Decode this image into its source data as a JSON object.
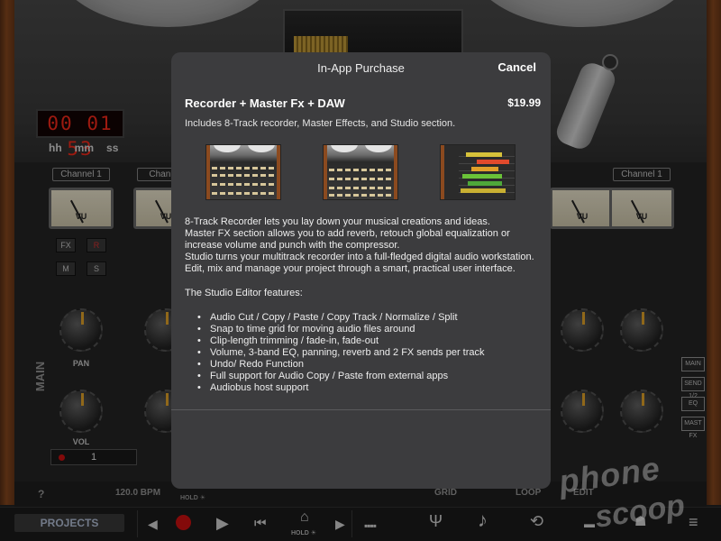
{
  "app": {
    "timer": "00 01 53",
    "timer_units": [
      "hh",
      "mm",
      "ss"
    ],
    "channel_label": "Channel 1",
    "channel_label_b": "Channel",
    "channel_label_c": "Channel 1",
    "vu_label": "VU",
    "fx_label": "FX",
    "r_label": "R",
    "m_label": "M",
    "s_label": "S",
    "pan_label": "PAN",
    "vol_label": "VOL",
    "track_number": "1",
    "main_label": "MAIN",
    "side_buttons": [
      "MAIN",
      "SEND 1/2",
      "EQ",
      "MAST FX"
    ]
  },
  "strip": {
    "help": "?",
    "bpm": "120.0 BPM",
    "hold": "HOLD ☀",
    "grid": "GRID",
    "loop": "LOOP",
    "edit": "EDIT"
  },
  "toolbar": {
    "projects": "PROJECTS",
    "hold": "HOLD ☀"
  },
  "watermark": {
    "line1": "phone",
    "line2": "scoop"
  },
  "modal": {
    "title": "In-App Purchase",
    "cancel": "Cancel",
    "product_name": "Recorder + Master Fx + DAW",
    "price": "$19.99",
    "includes": "Includes 8-Track recorder, Master Effects, and Studio section.",
    "desc_1": "8-Track Recorder lets you lay down your musical creations and ideas.",
    "desc_2": "Master FX section allows you to add reverb, retouch global equalization or increase volume and punch with the compressor.",
    "desc_3": "Studio turns your multitrack recorder into a full-fledged digital audio workstation.",
    "desc_4": "Edit, mix and manage your project through a smart, practical user interface.",
    "features_heading": "The Studio Editor features:",
    "features": [
      "Audio Cut / Copy / Paste / Copy Track / Normalize / Split",
      "Snap to time grid for moving audio files around",
      "Clip-length trimming / fade-in, fade-out",
      "Volume, 3-band EQ, panning, reverb and 2 FX sends per track",
      "Undo/ Redo Function",
      "Full support for Audio Copy / Paste from external apps",
      "Audiobus host support"
    ]
  },
  "colors": {
    "modal_bg": "#3c3c3e",
    "timer_red": "#ff2a1a",
    "record_red": "#d41111",
    "knob_accent": "#e8a82a"
  }
}
